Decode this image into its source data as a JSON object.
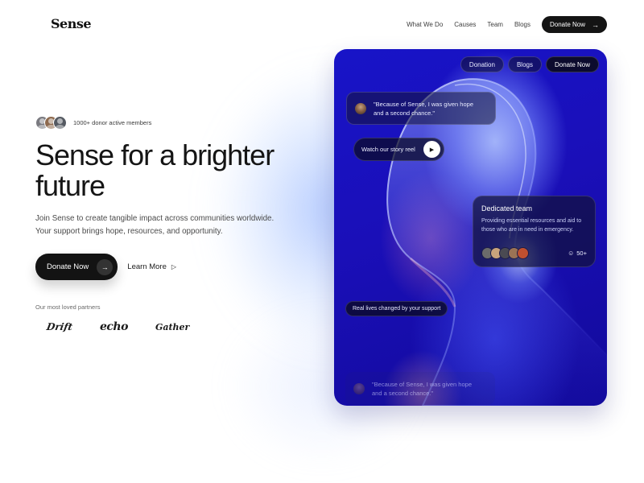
{
  "brand": {
    "logo": "Sense"
  },
  "nav": {
    "links": [
      "What We Do",
      "Causes",
      "Team",
      "Blogs"
    ],
    "cta": "Donate Now"
  },
  "hero": {
    "members_text": "1000+ donor active members",
    "headline_line1": "Sense for a brighter",
    "headline_line2": "future",
    "lead_line1": "Join Sense to create tangible impact across communities worldwide.",
    "lead_line2": "Your support brings hope, resources, and opportunity.",
    "primary_cta": "Donate Now",
    "secondary_cta": "Learn More",
    "partners_label": "Our most loved partners",
    "partners": [
      "Drift",
      "echo",
      "Gather"
    ]
  },
  "card": {
    "nav": [
      "Donation",
      "Blogs",
      "Donate Now"
    ],
    "quote_line1": "\"Because of Sense, I was given hope",
    "quote_line2": "and a second chance.\"",
    "story_label": "Watch our story reel",
    "team": {
      "title": "Dedicated team",
      "description": "Providing essential resources and aid to those who are in need in emergency.",
      "count": "50+"
    },
    "real_lives": "Real lives changed by your support",
    "ghost_quote_line1": "\"Because of Sense, I was given hope",
    "ghost_quote_line2": "and a second chance.\""
  },
  "colors": {
    "dark_button": "#131313",
    "card_blue": "#1814c8",
    "text_primary": "#151515"
  },
  "icons": {
    "cta_arrow": "arrow-right-icon",
    "play": "play-icon",
    "learn_more": "play-outline-icon",
    "users": "users-icon"
  }
}
